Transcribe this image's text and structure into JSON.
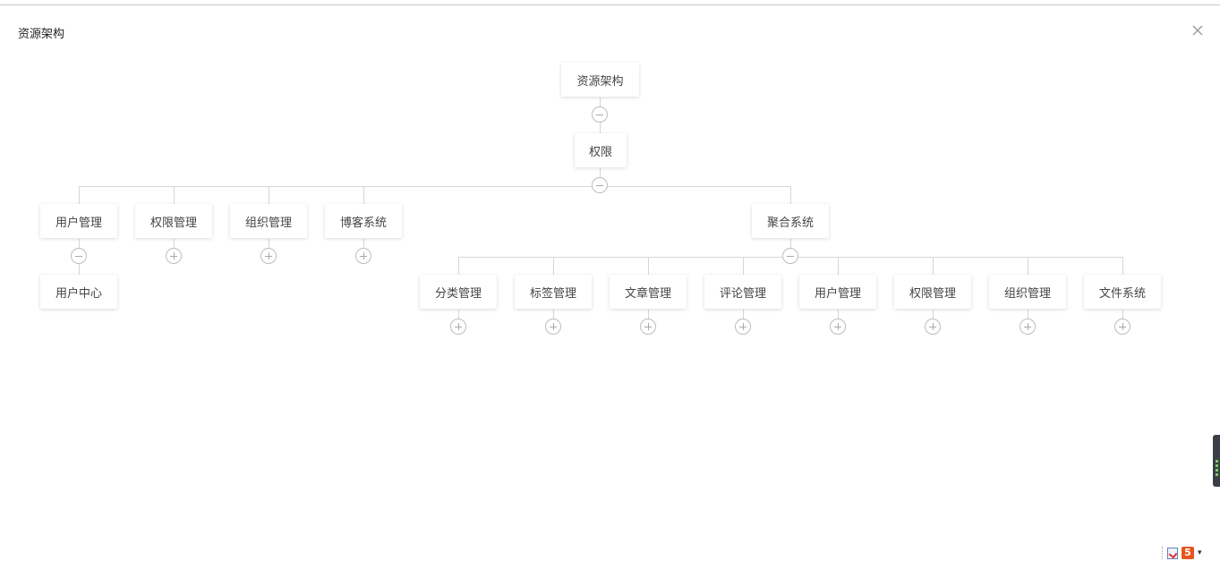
{
  "dialog": {
    "title": "资源架构",
    "close_icon": "close-icon"
  },
  "tree": {
    "root": {
      "label": "资源架构",
      "expanded": true
    },
    "level1": {
      "label": "权限",
      "expanded": true
    },
    "branches": [
      {
        "label": "用户管理",
        "expanded": true,
        "children": [
          "用户中心"
        ]
      },
      {
        "label": "权限管理",
        "expanded": false
      },
      {
        "label": "组织管理",
        "expanded": false
      },
      {
        "label": "博客系统",
        "expanded": false
      },
      {
        "label": "聚合系统",
        "expanded": true
      }
    ],
    "leaf_under_user": {
      "label": "用户中心"
    },
    "aggregate_children": [
      {
        "label": "分类管理",
        "expanded": false
      },
      {
        "label": "标签管理",
        "expanded": false
      },
      {
        "label": "文章管理",
        "expanded": false
      },
      {
        "label": "评论管理",
        "expanded": false
      },
      {
        "label": "用户管理",
        "expanded": false
      },
      {
        "label": "权限管理",
        "expanded": false
      },
      {
        "label": "组织管理",
        "expanded": false
      },
      {
        "label": "文件系统",
        "expanded": false
      }
    ]
  },
  "tray": {
    "icons": [
      "document-check-icon",
      "html5-icon",
      "dropdown-arrow-icon"
    ],
    "html5_glyph": "5",
    "arrow_glyph": "▾"
  }
}
